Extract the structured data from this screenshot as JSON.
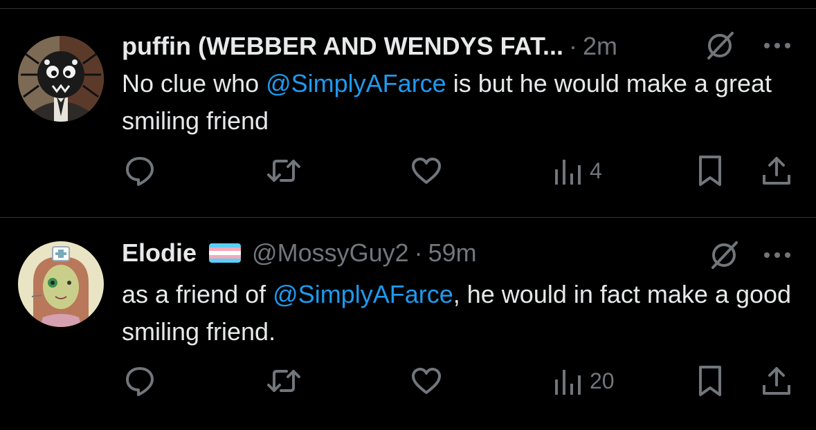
{
  "tweets": [
    {
      "display_name": "puffin (WEBBER AND WENDYS FAT...",
      "handle": "",
      "time": "2m",
      "text_before": "No clue who ",
      "mention": "@SimplyAFarce",
      "text_after": " is but he would make a great smiling friend",
      "views": "4",
      "avatar_icon": "spider-character-avatar"
    },
    {
      "display_name": "Elodie",
      "handle": "@MossyGuy2",
      "time": "59m",
      "text_before": "as a friend of ",
      "mention": "@SimplyAFarce",
      "text_after": ", he would in fact make a good smiling friend.",
      "views": "20",
      "avatar_icon": "nurse-character-avatar"
    }
  ],
  "colors": {
    "background": "#000000",
    "text": "#e7e9ea",
    "muted": "#71767b",
    "accent": "#1d9bf0",
    "divider": "#2f3336"
  },
  "icons": [
    "reply-icon",
    "retweet-icon",
    "like-icon",
    "views-icon",
    "bookmark-icon",
    "share-icon",
    "grok-icon",
    "more-icon",
    "trans-flag-icon"
  ]
}
